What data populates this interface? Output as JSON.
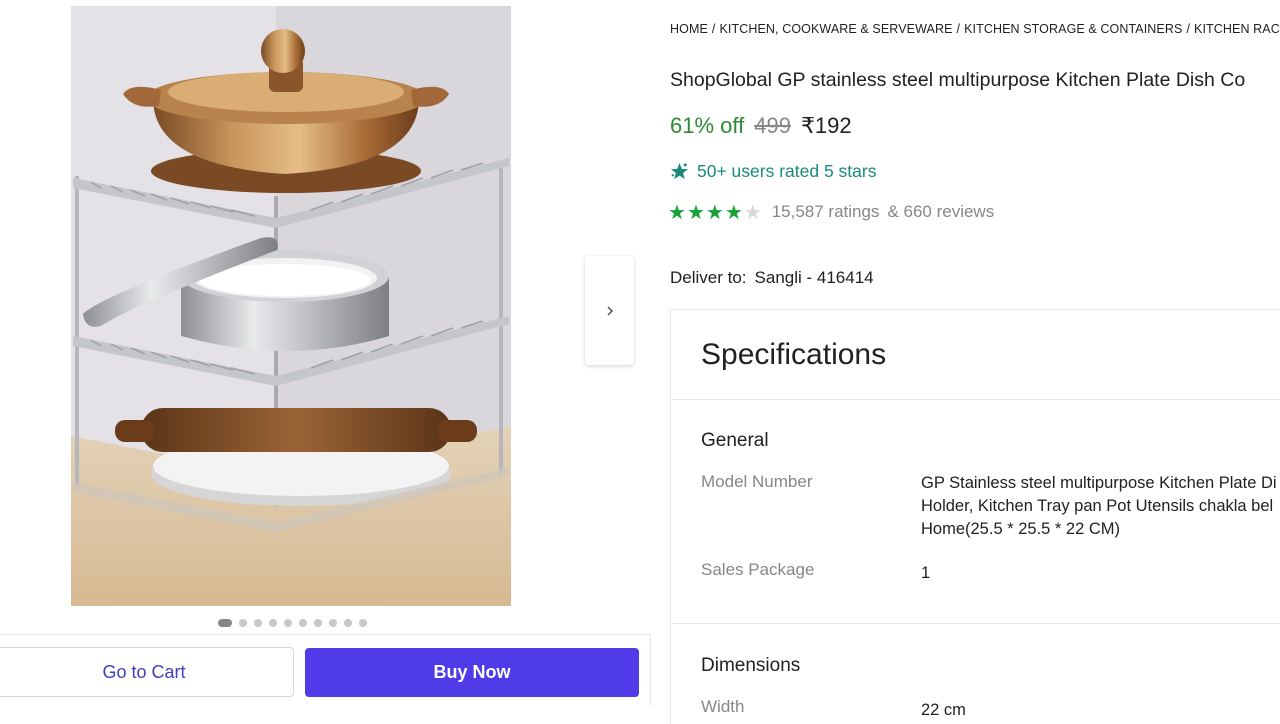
{
  "gallery": {
    "dot_count": 10,
    "active_dot": 0
  },
  "actions": {
    "go_to_cart": "Go to Cart",
    "buy_now": "Buy Now"
  },
  "breadcrumb": [
    "HOME",
    "KITCHEN, COOKWARE & SERVEWARE",
    "KITCHEN STORAGE & CONTAINERS",
    "KITCHEN RACKS"
  ],
  "breadcrumb_separator": "/",
  "product": {
    "title": "ShopGlobal GP stainless steel multipurpose Kitchen Plate Dish Co",
    "discount": "61% off",
    "mrp": "499",
    "price": "₹192",
    "rated_badge": "50+ users rated 5 stars",
    "rating_stars": 4,
    "rating_max": 5,
    "ratings_text": "15,587 ratings",
    "reviews_text": "& 660 reviews"
  },
  "delivery": {
    "label": "Deliver to:",
    "location": "Sangli - 416414"
  },
  "specifications": {
    "heading": "Specifications",
    "general": {
      "title": "General",
      "rows": [
        {
          "label": "Model Number",
          "value": "GP Stainless steel multipurpose Kitchen Plate Di Holder, Kitchen Tray pan Pot Utensils chakla bel Home(25.5 * 25.5 * 22 CM)"
        },
        {
          "label": "Sales Package",
          "value": "1"
        }
      ]
    },
    "dimensions": {
      "title": "Dimensions",
      "rows": [
        {
          "label": "Width",
          "value": "22 cm"
        }
      ]
    }
  },
  "colors": {
    "discount_green": "#2e8b35",
    "star_green": "#17a136",
    "badge_teal": "#1a8a7a",
    "buy_button": "#4f3be8",
    "cart_text": "#3b3fc0"
  },
  "icons": {
    "next": "chevron-right-icon",
    "badge": "sparkle-star-icon",
    "star": "star-icon"
  }
}
